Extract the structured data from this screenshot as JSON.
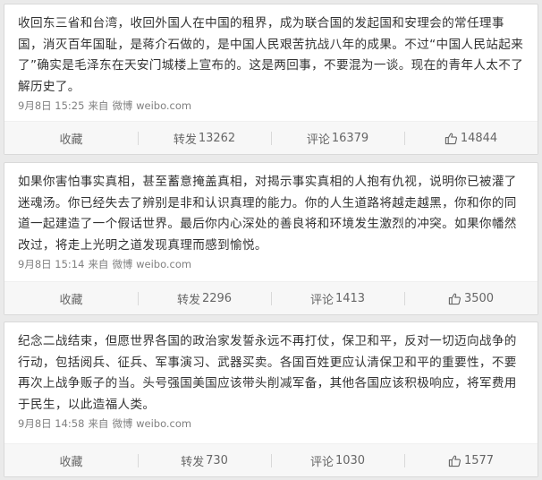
{
  "posts": [
    {
      "text": "收回东三省和台湾，收回外国人在中国的租界，成为联合国的发起国和安理会的常任理事国，消灭百年国耻，是蒋介石做的，是中国人民艰苦抗战八年的成果。不过“中国人民站起来了”确实是毛泽东在天安门城楼上宣布的。这是两回事，不要混为一谈。现在的青年人太不了解历史了。",
      "date": "9月8日 15:25",
      "source_prefix": "来自",
      "source": "微博 weibo.com",
      "collect_label": "收藏",
      "repost_label": "转发",
      "repost_count": "13262",
      "comment_label": "评论",
      "comment_count": "16379",
      "like_count": "14844"
    },
    {
      "text": "如果你害怕事实真相，甚至蓄意掩盖真相，对揭示事实真相的人抱有仇视，说明你已被灌了迷魂汤。你已经失去了辨别是非和认识真理的能力。你的人生道路将越走越黑，你和你的同道一起建造了一个假话世界。最后你内心深处的善良将和环境发生激烈的冲突。如果你幡然改过，将走上光明之道发现真理而感到愉悦。",
      "date": "9月8日 15:14",
      "source_prefix": "来自",
      "source": "微博 weibo.com",
      "collect_label": "收藏",
      "repost_label": "转发",
      "repost_count": "2296",
      "comment_label": "评论",
      "comment_count": "1413",
      "like_count": "3500"
    },
    {
      "text": "纪念二战结束，但愿世界各国的政治家发誓永远不再打仗，保卫和平，反对一切迈向战争的行动，包括阅兵、征兵、军事演习、武器买卖。各国百姓更应认清保卫和平的重要性，不要再次上战争贩子的当。头号强国美国应该带头削减军备，其他各国应该积极响应，将军费用于民生，以此造福人类。",
      "date": "9月8日 14:58",
      "source_prefix": "来自",
      "source": "微博 weibo.com",
      "collect_label": "收藏",
      "repost_label": "转发",
      "repost_count": "730",
      "comment_label": "评论",
      "comment_count": "1030",
      "like_count": "1577"
    }
  ],
  "icons": {
    "like": "thumbs-up-icon"
  },
  "colors": {
    "page_bg": "#eaeaea",
    "card_bg": "#ffffff",
    "action_bar_bg": "#f7f7f7",
    "text": "#333333",
    "meta": "#808080"
  }
}
